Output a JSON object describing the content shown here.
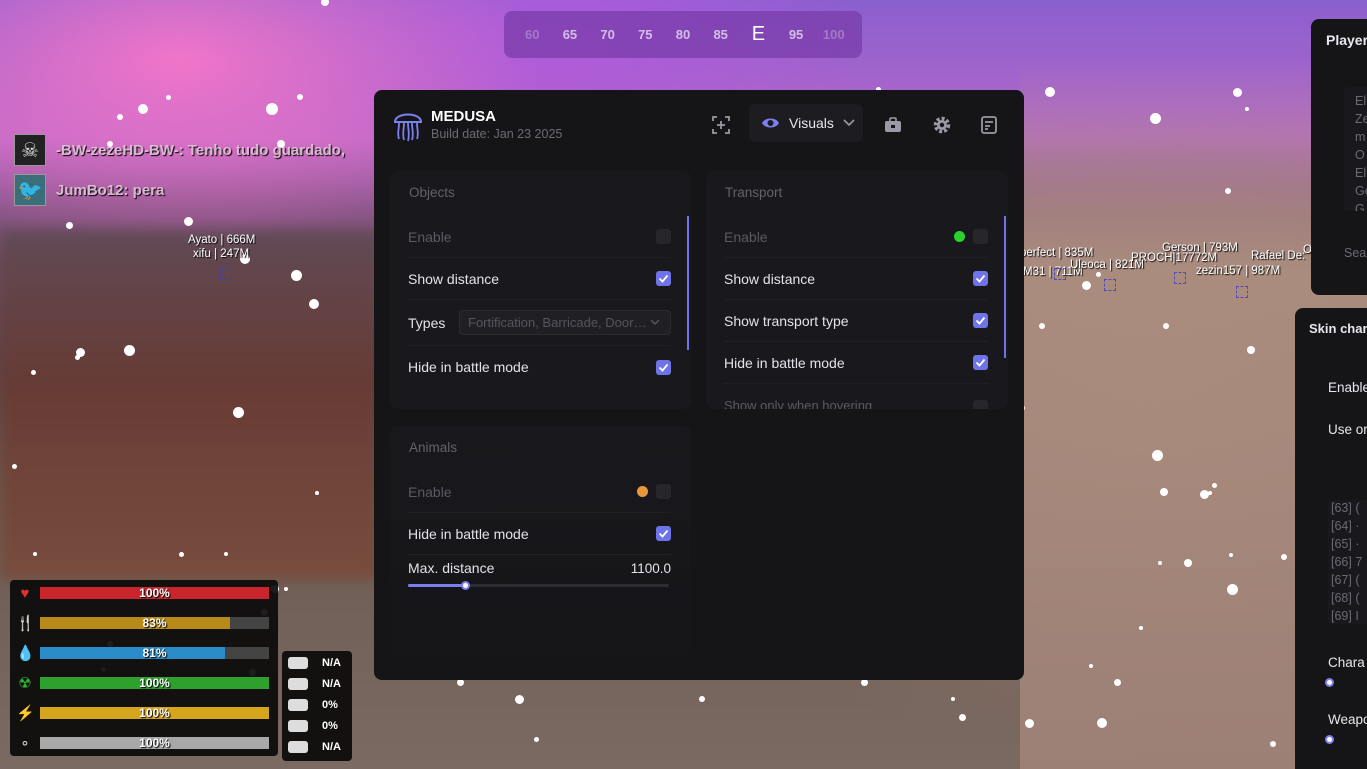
{
  "compass": {
    "ticks": [
      "60",
      "65",
      "70",
      "75",
      "80",
      "85",
      "E",
      "95",
      "100"
    ]
  },
  "chat": [
    {
      "avatar_icon": "skull-icon",
      "text": "-BW-zezeHD-BW-: Tenho tudo guardado,"
    },
    {
      "avatar_icon": "pigeon-icon",
      "text": "JumBo12: pera"
    }
  ],
  "world_labels": {
    "ayato": "Ayato | 666M",
    "xifu": "xifu | 247M",
    "perfect": "perfect | 835M",
    "m31": "M31 | 711M",
    "uleoca": "Uleoca | 821M",
    "gerson": "Gerson | 793M",
    "proch": "PROCH|17772M",
    "zezin": "zezin157 | 987M",
    "rafael": "Rafael De:",
    "o": "O"
  },
  "hud": {
    "bars": [
      {
        "icon": "heart-icon",
        "label": "100%",
        "value": 100,
        "color": "#c8262c",
        "icon_color": "#e0302f"
      },
      {
        "icon": "fork-knife-icon",
        "label": "83%",
        "value": 83,
        "color": "#b88a1a",
        "icon_color": "#c99a22"
      },
      {
        "icon": "water-drop-icon",
        "label": "81%",
        "value": 81,
        "color": "#2a8cc8",
        "icon_color": "#2b9bd9"
      },
      {
        "icon": "radiation-icon",
        "label": "100%",
        "value": 100,
        "color": "#2ea02e",
        "icon_color": "#2fb52f"
      },
      {
        "icon": "lightning-icon",
        "label": "100%",
        "value": 100,
        "color": "#d6a51e",
        "icon_color": "#e5b324"
      },
      {
        "icon": "bubbles-icon",
        "label": "100%",
        "value": 100,
        "color": "#a8a8a8",
        "icon_color": "#ddd"
      }
    ],
    "equipment": [
      "N/A",
      "N/A",
      "0%",
      "0%",
      "N/A"
    ]
  },
  "panel": {
    "title": "MEDUSA",
    "build_date": "Build date: Jan 23 2025",
    "tab": "Visuals",
    "objects": {
      "title": "Objects",
      "enable": "Enable",
      "show_distance": "Show distance",
      "types_label": "Types",
      "types_value": "Fortification, Barricade, Door…",
      "hide_battle": "Hide in battle mode"
    },
    "animals": {
      "title": "Animals",
      "enable": "Enable",
      "hide_battle": "Hide in battle mode",
      "max_distance_label": "Max. distance",
      "max_distance_value": "1100.0",
      "slider_fraction": 0.22
    },
    "transport": {
      "title": "Transport",
      "enable": "Enable",
      "show_distance": "Show distance",
      "show_type": "Show transport type",
      "hide_battle": "Hide in battle mode",
      "show_hover": "Show only when hovering"
    },
    "colors": {
      "accent": "#6f73e8",
      "green_dot": "#2bd22b",
      "orange_dot": "#e8983a"
    }
  },
  "side": {
    "player_title": "Player",
    "player_list": [
      "El",
      "Ze",
      "m",
      "O",
      "El",
      "Ge",
      "G"
    ],
    "search": "Sea",
    "skin_title": "Skin char",
    "enable": "Enable",
    "use_on": "Use or",
    "list": [
      "[63] (",
      "[64] ·",
      "[65] ·",
      "[66] 7",
      "[67] (",
      "[68] (",
      "[69] I"
    ],
    "character": "Chara",
    "weapon": "Weapo"
  }
}
